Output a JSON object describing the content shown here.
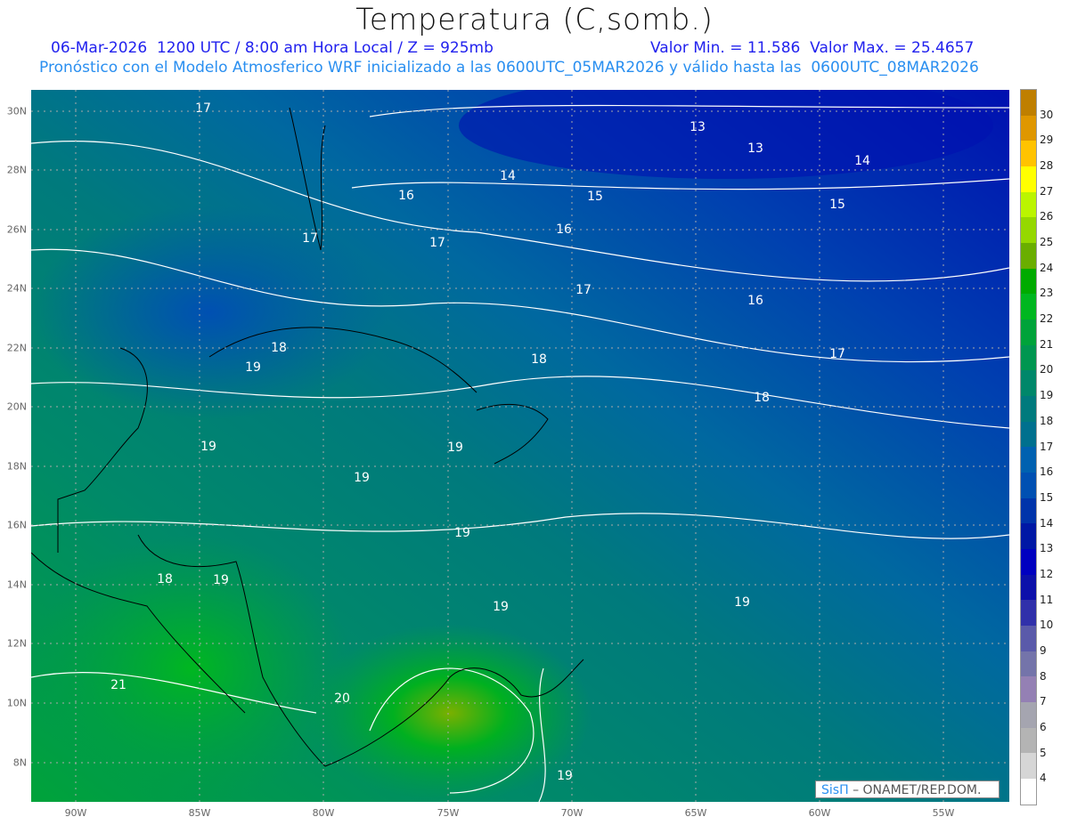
{
  "header": {
    "title": "Temperatura (C,somb.)",
    "line1": "06-Mar-2026  1200 UTC / 8:00 am Hora Local / Z = 925mb",
    "min_max": "Valor Min. = 11.586  Valor Max. = 25.4657",
    "line2": "Pronóstico con el Modelo Atmosferico WRF inicializado a las 0600UTC_05MAR2026 y válido hasta las  0600UTC_08MAR2026"
  },
  "axes": {
    "lat_labels": [
      "30N",
      "28N",
      "26N",
      "24N",
      "22N",
      "20N",
      "18N",
      "16N",
      "14N",
      "12N",
      "10N",
      "8N"
    ],
    "lon_labels": [
      "90W",
      "85W",
      "80W",
      "75W",
      "70W",
      "65W",
      "60W",
      "55W"
    ]
  },
  "colorbar": {
    "labels": [
      "30",
      "29",
      "28",
      "27",
      "26",
      "25",
      "24",
      "23",
      "22",
      "21",
      "20",
      "19",
      "18",
      "17",
      "16",
      "15",
      "14",
      "13",
      "12",
      "11",
      "10",
      "9",
      "8",
      "7",
      "6",
      "5",
      "4"
    ],
    "colors": [
      "#bf7f00",
      "#df9700",
      "#ffc300",
      "#ffff00",
      "#bbf500",
      "#95d800",
      "#6aae00",
      "#00ab00",
      "#00b720",
      "#00a33a",
      "#009650",
      "#00876a",
      "#007a7d",
      "#00708e",
      "#0061b0",
      "#0050b2",
      "#0034aa",
      "#0018a5",
      "#0000c0",
      "#0c10aa",
      "#3030aa",
      "#5a5aaa",
      "#7474aa",
      "#9480b4",
      "#a5a5b0",
      "#b4b4b4",
      "#d6d6d6",
      "#ffffff"
    ]
  },
  "map": {
    "contour_labels": [
      "17",
      "13",
      "13",
      "14",
      "14",
      "16",
      "15",
      "15",
      "16",
      "17",
      "17",
      "17",
      "16",
      "18",
      "17",
      "18",
      "19",
      "18",
      "19",
      "19",
      "19",
      "19",
      "18",
      "19",
      "19",
      "19",
      "21",
      "20",
      "19"
    ]
  },
  "credit": {
    "logo": "SisΠ",
    "text": "– ONAMET/REP.DOM."
  }
}
